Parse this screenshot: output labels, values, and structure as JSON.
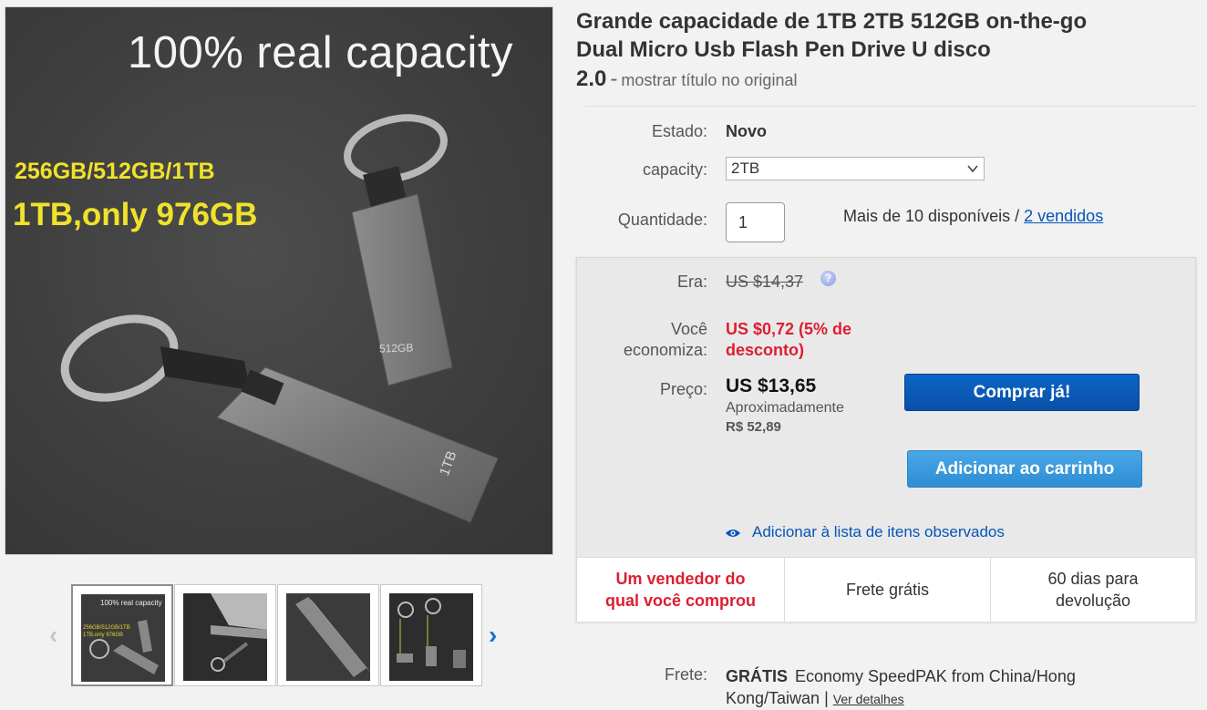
{
  "image": {
    "caption_top": "100% real capacity",
    "caption_sizes": "256GB/512GB/1TB",
    "caption_only": "1TB,only 976GB",
    "drive_label_small": "512GB",
    "drive_label_large": "1TB",
    "thumb_caption": "100% real capacity"
  },
  "title": {
    "line1": "Grande capacidade de 1TB 2TB 512GB on-the-go",
    "line2": "Dual Micro Usb Flash Pen Drive U disco",
    "line3": "2.0",
    "separator": "-",
    "show_original": "mostrar título no original"
  },
  "specs": {
    "condition_label": "Estado:",
    "condition_value": "Novo",
    "capacity_label": "capacity:",
    "capacity_value": "2TB",
    "quantity_label": "Quantidade:",
    "quantity_value": "1",
    "availability": "Mais de 10 disponíveis /",
    "sold_link": "2 vendidos"
  },
  "pricing": {
    "was_label": "Era:",
    "was_value": "US $14,37",
    "help_icon": "?",
    "save_label_1": "Você",
    "save_label_2": "economiza:",
    "save_value_1": "US $0,72 (5% de",
    "save_value_2": "desconto)",
    "price_label": "Preço:",
    "price_value": "US $13,65",
    "approx_label": "Aproximadamente",
    "approx_value": "R$ 52,89"
  },
  "actions": {
    "buy_now": "Comprar já!",
    "add_to_cart": "Adicionar ao carrinho",
    "watch": "Adicionar à lista de itens observados"
  },
  "features": {
    "seller_1": "Um vendedor do",
    "seller_2": "qual você comprou",
    "free_shipping": "Frete grátis",
    "returns_1": "60 dias para",
    "returns_2": "devolução"
  },
  "shipping": {
    "label": "Frete:",
    "free": "GRÁTIS",
    "method_1": "Economy SpeedPAK from China/Hong",
    "method_2": "Kong/Taiwan |",
    "details_link": "Ver detalhes"
  },
  "colors": {
    "buy_button": "#0950a8",
    "cart_button": "#2e8dd4",
    "savings_red": "#dd1e31",
    "link_blue": "#0654ba",
    "caption_yellow": "#f0e22b"
  }
}
